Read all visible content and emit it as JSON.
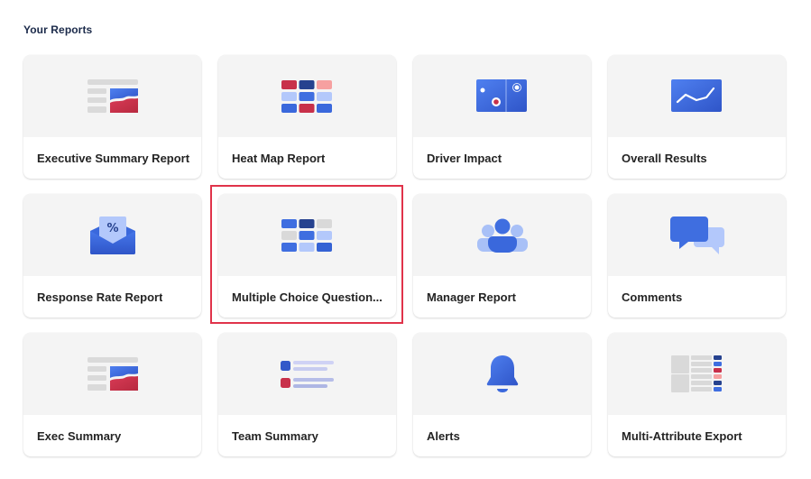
{
  "section": {
    "title": "Your Reports"
  },
  "colors": {
    "accent_blue": "#3f6ee0",
    "dark_blue": "#26428f",
    "light_blue": "#b3c8fb",
    "red": "#c8304a",
    "pink": "#f6a0a0",
    "gray": "#d9d9d9",
    "selection_outline": "#e0334a"
  },
  "reports": [
    {
      "label": "Executive Summary Report",
      "icon": "executive-summary-icon"
    },
    {
      "label": "Heat Map Report",
      "icon": "heat-map-icon"
    },
    {
      "label": "Driver Impact",
      "icon": "driver-impact-icon"
    },
    {
      "label": "Overall Results",
      "icon": "line-chart-icon"
    },
    {
      "label": "Response Rate Report",
      "icon": "envelope-percent-icon"
    },
    {
      "label": "Multiple Choice Question...",
      "icon": "multiple-choice-grid-icon",
      "selected": true
    },
    {
      "label": "Manager Report",
      "icon": "people-group-icon"
    },
    {
      "label": "Comments",
      "icon": "chat-bubbles-icon"
    },
    {
      "label": "Exec Summary",
      "icon": "executive-summary-icon"
    },
    {
      "label": "Team Summary",
      "icon": "team-list-icon"
    },
    {
      "label": "Alerts",
      "icon": "bell-icon"
    },
    {
      "label": "Multi-Attribute Export",
      "icon": "multi-attribute-table-icon"
    }
  ]
}
